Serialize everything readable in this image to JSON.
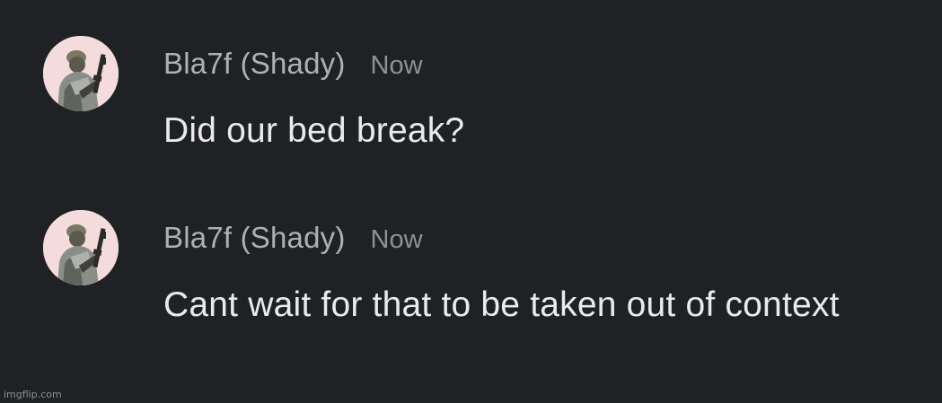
{
  "messages": [
    {
      "author": "Bla7f (Shady)",
      "timestamp": "Now",
      "text": "Did our bed break?",
      "avatar_icon": "soldier-avatar-icon"
    },
    {
      "author": "Bla7f (Shady)",
      "timestamp": "Now",
      "text": "Cant wait for that to be taken out of context",
      "avatar_icon": "soldier-avatar-icon"
    }
  ],
  "watermark": "imgflip.com",
  "colors": {
    "background": "#202125",
    "author": "#aeb0b4",
    "timestamp": "#8e9196",
    "message_text": "#e9eaec"
  }
}
